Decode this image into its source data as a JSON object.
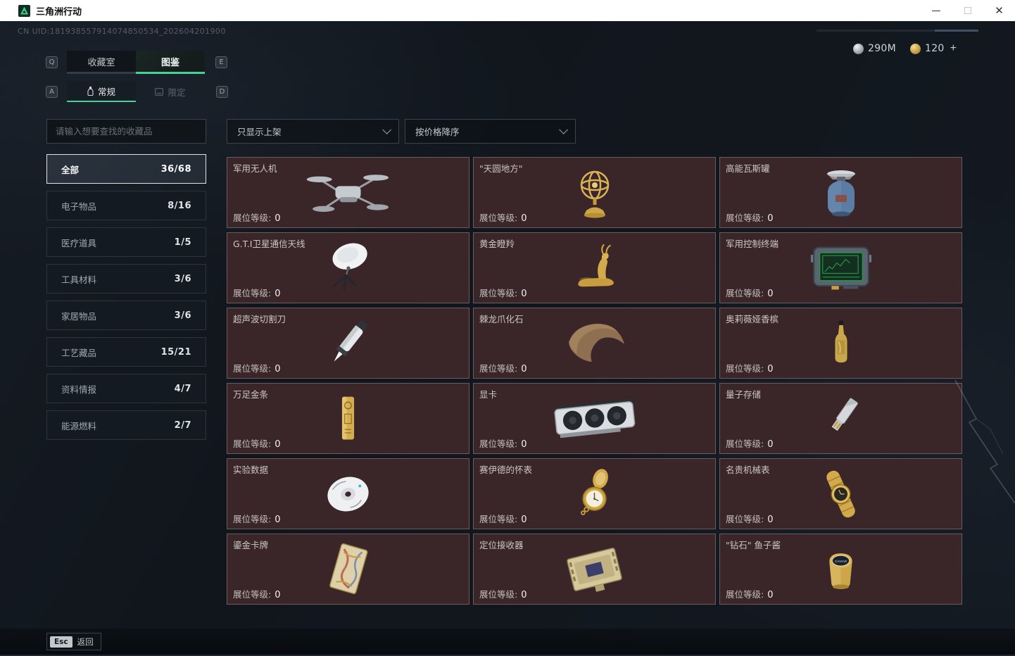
{
  "window": {
    "title": "三角洲行动"
  },
  "header": {
    "uid": "CN UID:181938557914074850534_202604201900",
    "currencies": [
      {
        "icon": "silver-coin-icon",
        "value": "290M"
      },
      {
        "icon": "gold-coin-icon",
        "value": "120",
        "add_label": "+"
      }
    ]
  },
  "tabs": {
    "left_key": "Q",
    "right_key": "E",
    "items": [
      {
        "label": "收藏室",
        "active": false
      },
      {
        "label": "图鉴",
        "active": true
      }
    ]
  },
  "subtabs": {
    "left_key": "A",
    "right_key": "D",
    "items": [
      {
        "label": "常规",
        "icon": "flask-icon",
        "active": true
      },
      {
        "label": "限定",
        "icon": "limited-card-icon",
        "active": false
      }
    ]
  },
  "filters": {
    "search_placeholder": "请输入想要查找的收藏品",
    "dropdowns": [
      "只显示上架",
      "按价格降序"
    ]
  },
  "sidebar": {
    "items": [
      {
        "label": "全部",
        "count": "36/68",
        "active": true
      },
      {
        "label": "电子物品",
        "count": "8/16",
        "active": false
      },
      {
        "label": "医疗道具",
        "count": "1/5",
        "active": false
      },
      {
        "label": "工具材料",
        "count": "3/6",
        "active": false
      },
      {
        "label": "家居物品",
        "count": "3/6",
        "active": false
      },
      {
        "label": "工艺藏品",
        "count": "15/21",
        "active": false
      },
      {
        "label": "资料情报",
        "count": "4/7",
        "active": false
      },
      {
        "label": "能源燃料",
        "count": "2/7",
        "active": false
      }
    ]
  },
  "grid": {
    "level_label": "展位等级:",
    "level_value": "0",
    "items": [
      {
        "name": "军用无人机",
        "icon": "drone"
      },
      {
        "name": "\"天圆地方\"",
        "icon": "armillary"
      },
      {
        "name": "高能瓦斯罐",
        "icon": "gas-canister"
      },
      {
        "name": "G.T.I卫星通信天线",
        "icon": "satellite-dish"
      },
      {
        "name": "黄金瞪羚",
        "icon": "golden-gazelle"
      },
      {
        "name": "军用控制终端",
        "icon": "control-terminal"
      },
      {
        "name": "超声波切割刀",
        "icon": "ultrasonic-cutter"
      },
      {
        "name": "棘龙爪化石",
        "icon": "claw-fossil"
      },
      {
        "name": "奥莉薇娅香槟",
        "icon": "champagne"
      },
      {
        "name": "万足金条",
        "icon": "gold-bar"
      },
      {
        "name": "显卡",
        "icon": "gpu"
      },
      {
        "name": "量子存储",
        "icon": "usb-drive"
      },
      {
        "name": "实验数据",
        "icon": "data-disc"
      },
      {
        "name": "赛伊德的怀表",
        "icon": "pocket-watch"
      },
      {
        "name": "名贵机械表",
        "icon": "wristwatch"
      },
      {
        "name": "鎏金卡牌",
        "icon": "gilded-card"
      },
      {
        "name": "定位接收器",
        "icon": "receiver"
      },
      {
        "name": "\"钻石\" 鱼子酱",
        "icon": "caviar-tin"
      }
    ]
  },
  "footer": {
    "key": "Esc",
    "label": "返回"
  },
  "colors": {
    "accent_green": "#43d39a",
    "card_bg": "#3a2528",
    "page_bg": "#12171e",
    "titlebar_bg": "#ffffff"
  }
}
